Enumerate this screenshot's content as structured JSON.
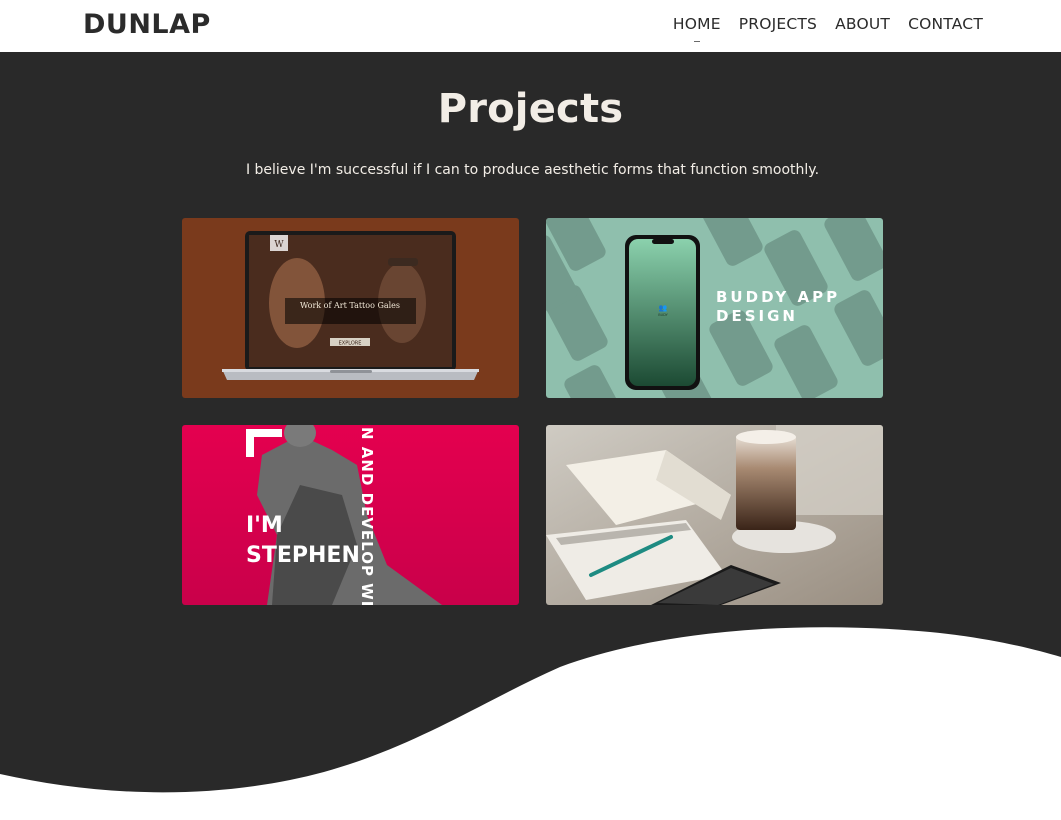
{
  "nav": {
    "brand": "DUNLAP",
    "links": [
      {
        "label": "HOME",
        "active": true
      },
      {
        "label": "PROJECTS",
        "active": false
      },
      {
        "label": "ABOUT",
        "active": false
      },
      {
        "label": "CONTACT",
        "active": false
      }
    ]
  },
  "main": {
    "title": "Projects",
    "subtitle": "I believe I'm successful if I can to produce aesthetic forms that function smoothly."
  },
  "projects": [
    {
      "name": "Work of Art Tattoo Gales",
      "thumb_text": "Work of Art Tattoo Gales",
      "thumb_button": "EXPLORE",
      "thumb_logo": "W",
      "bg_color": "#7a3a1c"
    },
    {
      "name": "Buddy App Design",
      "thumb_text_line1": "BUDDY APP",
      "thumb_text_line2": "DESIGN",
      "thumb_logo": "BUDY",
      "bg_color": "#8fbfad"
    },
    {
      "name": "I'm Stephen",
      "thumb_text_line1": "I'M",
      "thumb_text_line2": "STEPHEN",
      "thumb_vertical": "N AND DEVELOP WE",
      "bg_color": "#d6004a"
    },
    {
      "name": "Notebook and coffee",
      "bg_color": "#bdb8ae"
    }
  ],
  "colors": {
    "dark_bg": "#292929",
    "light_text": "#f2ede6",
    "nav_text": "#2b2b2b"
  }
}
